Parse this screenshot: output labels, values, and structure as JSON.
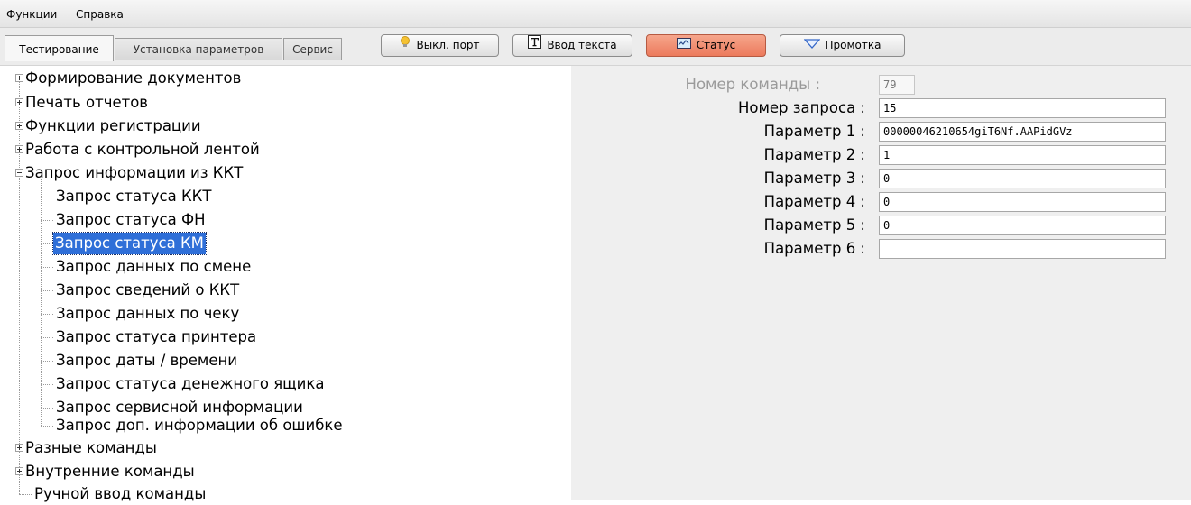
{
  "menubar": {
    "items": [
      "Функции",
      "Справка"
    ]
  },
  "tabs": [
    {
      "label": "Тестирование",
      "active": true
    },
    {
      "label": "Установка параметров",
      "active": false
    },
    {
      "label": "Сервис",
      "active": false
    }
  ],
  "toolbar": {
    "port_button": {
      "label": "Выкл. порт",
      "icon": "lightbulb-icon"
    },
    "text_button": {
      "label": "Ввод текста",
      "icon": "text-t-icon"
    },
    "status_button": {
      "label": "Статус",
      "icon": "monitor-icon",
      "accent": "#ec7a5c"
    },
    "feed_button": {
      "label": "Промотка",
      "icon": "triangle-down-icon"
    }
  },
  "tree": {
    "nodes": [
      {
        "label": "Формирование документов",
        "level": 0,
        "expander": "plus"
      },
      {
        "label": "Печать отчетов",
        "level": 0,
        "expander": "plus"
      },
      {
        "label": "Функции регистрации",
        "level": 0,
        "expander": "plus"
      },
      {
        "label": "Работа с контрольной лентой",
        "level": 0,
        "expander": "plus"
      },
      {
        "label": "Запрос информации из ККТ",
        "level": 0,
        "expander": "minus"
      },
      {
        "label": "Запрос статуса ККТ",
        "level": 1
      },
      {
        "label": "Запрос статуса ФН",
        "level": 1
      },
      {
        "label": "Запрос статуса КМ",
        "level": 1,
        "selected": true
      },
      {
        "label": "Запрос данных по смене",
        "level": 1
      },
      {
        "label": "Запрос сведений о ККТ",
        "level": 1
      },
      {
        "label": "Запрос данных по чеку",
        "level": 1
      },
      {
        "label": "Запрос статуса принтера",
        "level": 1
      },
      {
        "label": "Запрос даты / времени",
        "level": 1
      },
      {
        "label": "Запрос статуса денежного ящика",
        "level": 1
      },
      {
        "label": "Запрос сервисной информации",
        "level": 1
      },
      {
        "label": "Запрос доп. информации об ошибке",
        "level": 1
      },
      {
        "label": "Разные команды",
        "level": 0,
        "expander": "plus"
      },
      {
        "label": "Внутренние команды",
        "level": 0,
        "expander": "plus"
      },
      {
        "label": "Ручной ввод команды",
        "level": 0
      }
    ],
    "selection_color": "#2f6fd8"
  },
  "form": {
    "command_number": {
      "label": "Номер команды :",
      "value": "79",
      "disabled": true
    },
    "request_number": {
      "label": "Номер запроса :",
      "value": "15"
    },
    "params": [
      {
        "label": "Параметр 1 :",
        "value": "00000046210654giT6Nf.AAPidGVz"
      },
      {
        "label": "Параметр 2 :",
        "value": "1"
      },
      {
        "label": "Параметр 3 :",
        "value": "0"
      },
      {
        "label": "Параметр 4 :",
        "value": "0"
      },
      {
        "label": "Параметр 5 :",
        "value": "0"
      },
      {
        "label": "Параметр 6 :",
        "value": ""
      }
    ]
  }
}
